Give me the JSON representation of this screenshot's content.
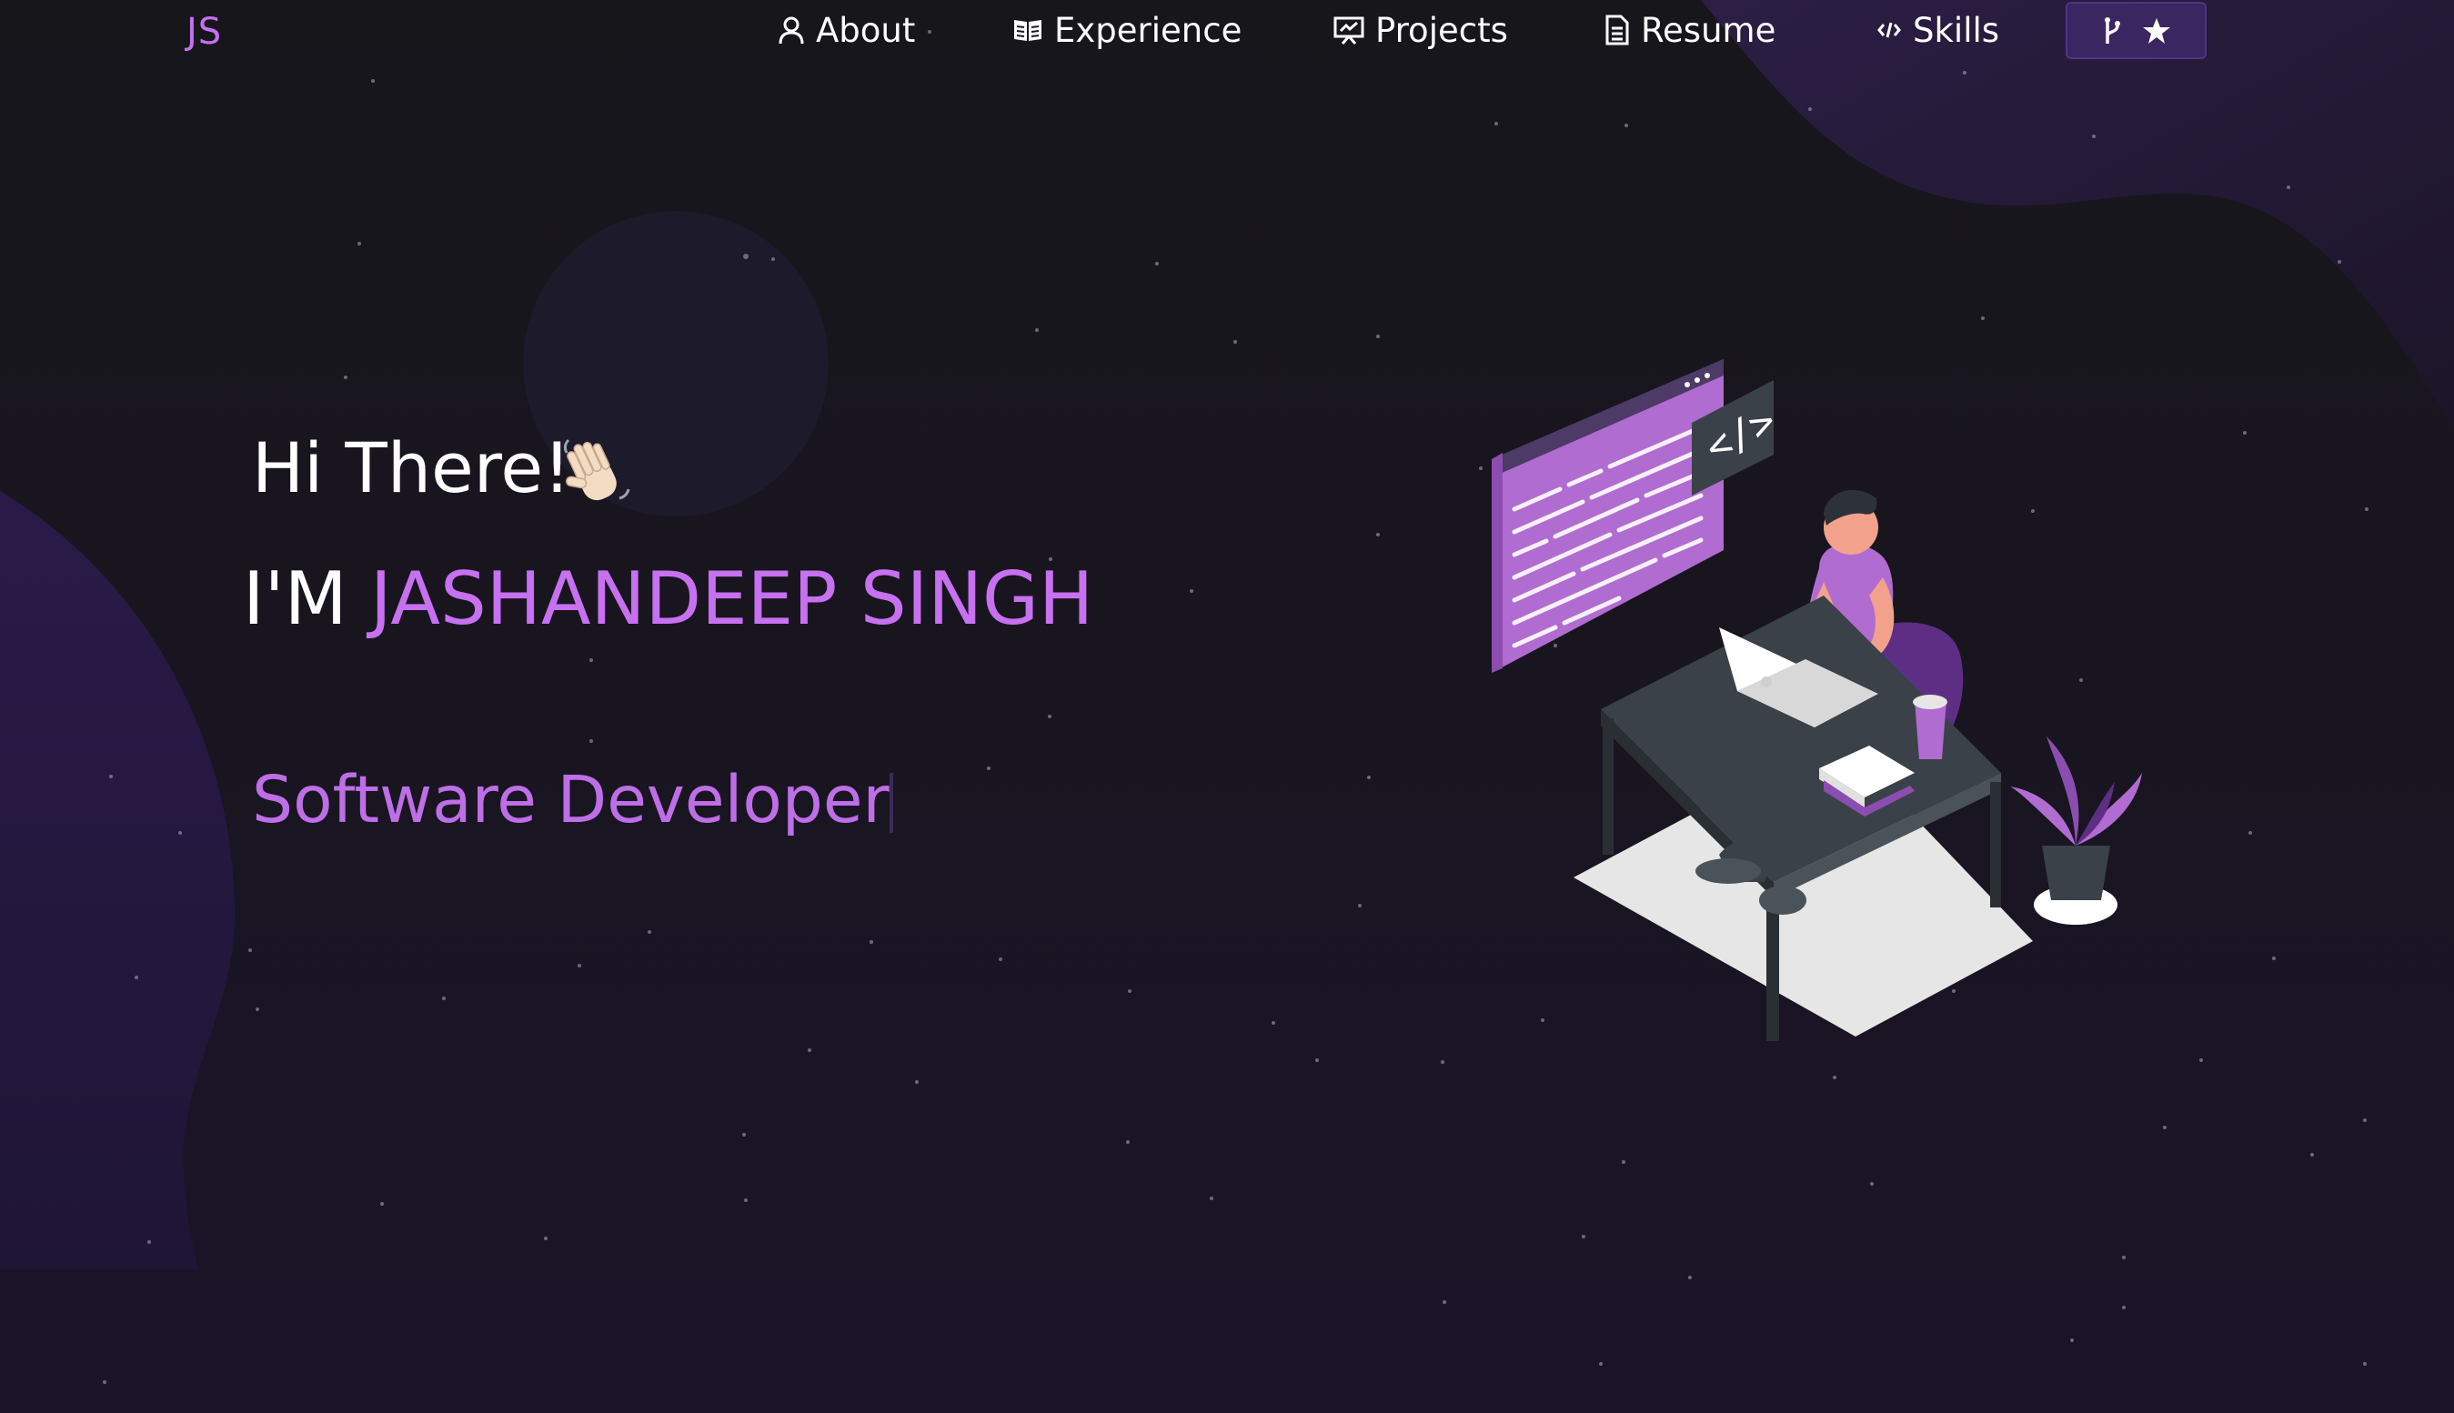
{
  "nav": {
    "logo": "JS",
    "items": [
      {
        "label": "About",
        "icon": "user-icon"
      },
      {
        "label": "Experience",
        "icon": "book-icon"
      },
      {
        "label": "Projects",
        "icon": "presentation-icon"
      },
      {
        "label": "Resume",
        "icon": "document-icon"
      },
      {
        "label": "Skills",
        "icon": "code-icon"
      }
    ],
    "fork_button": {
      "icons": [
        "git-fork-icon",
        "star-icon"
      ]
    }
  },
  "hero": {
    "greeting": "Hi There!",
    "greeting_emoji": "waving-hand-icon",
    "name_prefix": "I'M",
    "name": "JASHANDEEP SINGH",
    "role": "Software Developer"
  },
  "colors": {
    "accent": "#c770f0",
    "background": "#17161b",
    "button_bg": "#3a2660"
  }
}
